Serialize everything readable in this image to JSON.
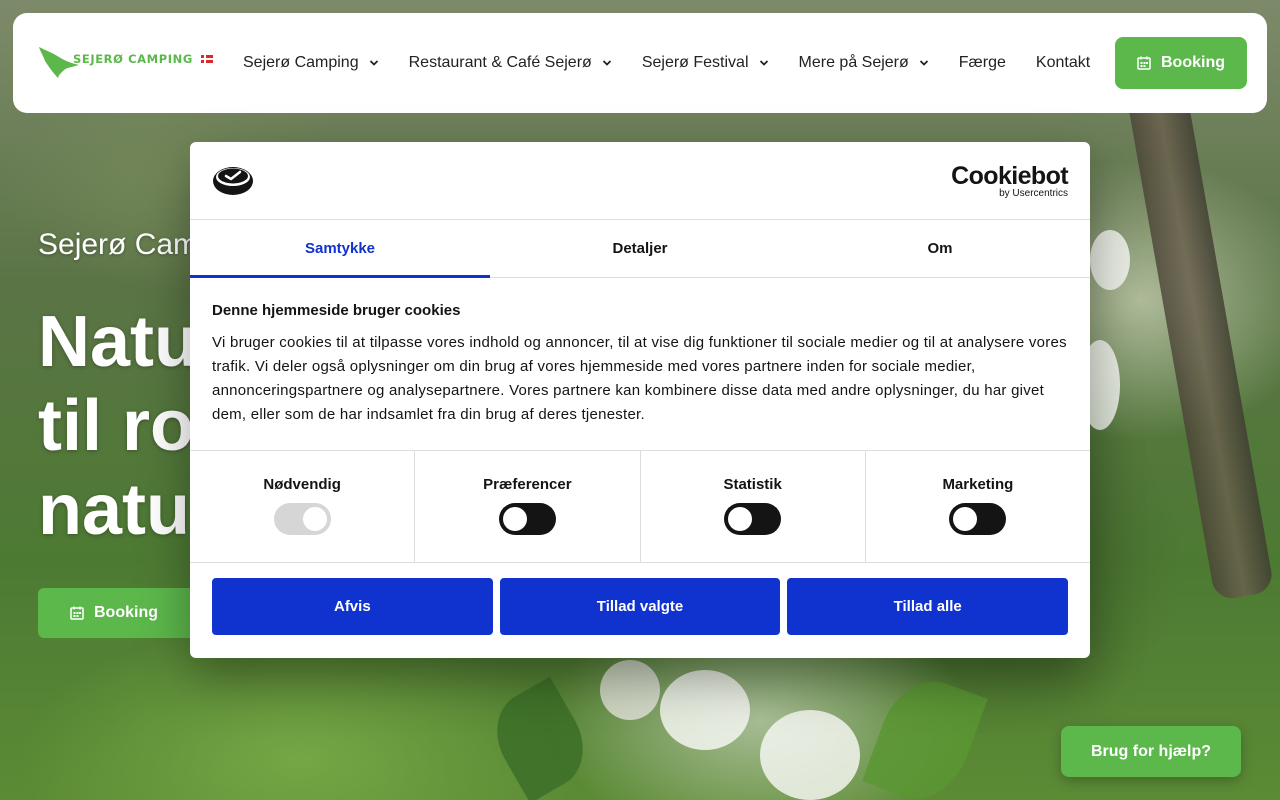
{
  "colors": {
    "brand_green": "#5cb84b",
    "cookiebot_blue": "#1032cf"
  },
  "nav": {
    "logo_text": "SEJERØ CAMPING",
    "items": [
      {
        "label": "Sejerø Camping",
        "has_dropdown": true
      },
      {
        "label": "Restaurant & Café Sejerø",
        "has_dropdown": true
      },
      {
        "label": "Sejerø Festival",
        "has_dropdown": true
      },
      {
        "label": "Mere på Sejerø",
        "has_dropdown": true
      },
      {
        "label": "Færge",
        "has_dropdown": false
      },
      {
        "label": "Kontakt",
        "has_dropdown": false
      }
    ],
    "booking_label": "Booking",
    "booking_icon": "calendar-icon"
  },
  "hero": {
    "subtitle": "Sejerø Cam",
    "title_lines": [
      "Natu",
      "til ro",
      "natu"
    ],
    "booking_label": "Booking"
  },
  "cookie_dialog": {
    "brand_name": "Cookiebot",
    "brand_by": "by Usercentrics",
    "tabs": [
      {
        "label": "Samtykke",
        "active": true
      },
      {
        "label": "Detaljer",
        "active": false
      },
      {
        "label": "Om",
        "active": false
      }
    ],
    "heading": "Denne hjemmeside bruger cookies",
    "body": "Vi bruger cookies til at tilpasse vores indhold og annoncer, til at vise dig funktioner til sociale medier og til at analysere vores trafik. Vi deler også oplysninger om din brug af vores hjemmeside med vores partnere inden for sociale medier, annonceringspartnere og analysepartnere. Vores partnere kan kombinere disse data med andre oplysninger, du har givet dem, eller som de har indsamlet fra din brug af deres tjenester.",
    "toggles": [
      {
        "label": "Nødvendig",
        "state": "on-disabled"
      },
      {
        "label": "Præferencer",
        "state": "off"
      },
      {
        "label": "Statistik",
        "state": "off"
      },
      {
        "label": "Marketing",
        "state": "off"
      }
    ],
    "buttons": {
      "reject": "Afvis",
      "allow_selected": "Tillad valgte",
      "allow_all": "Tillad alle"
    }
  },
  "help_button": "Brug for hjælp?"
}
